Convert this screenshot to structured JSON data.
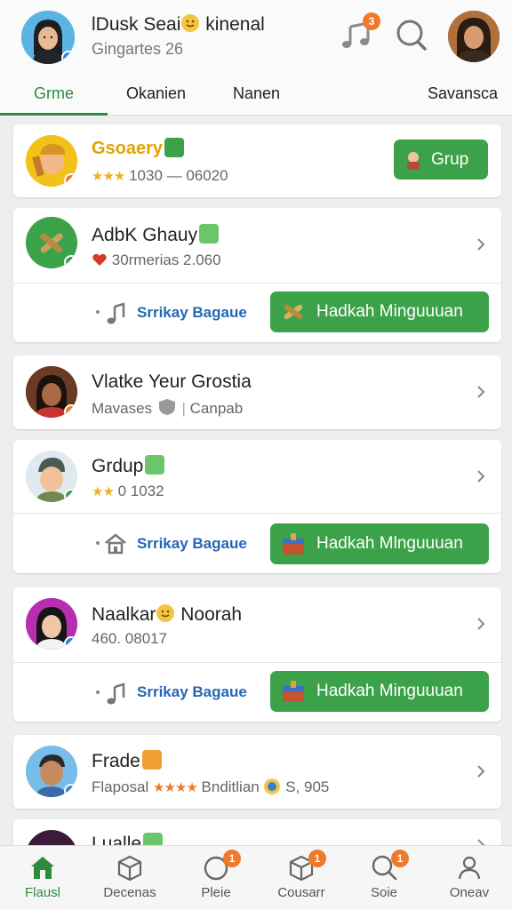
{
  "header": {
    "name": "lDusk Seai",
    "name_suffix": "kinenal",
    "subtitle": "Gingartes 26",
    "notification_count": "3"
  },
  "tabs": [
    {
      "label": "Grme",
      "active": true
    },
    {
      "label": "Okanien",
      "active": false
    },
    {
      "label": "Nanen",
      "active": false
    },
    {
      "label": "Savansca",
      "active": false
    }
  ],
  "items": [
    {
      "title": "Gsoaery",
      "meta_stars": "★★★",
      "meta_text": "1030 — 06020",
      "button": "Grup"
    },
    {
      "title": "AdbK Ghauy",
      "meta_text": "30rmerias  2.060",
      "action_left": "Srrikay Bagaue",
      "action_button": "Hadkah Minguuuan"
    },
    {
      "title": "Vlatke Yeur Grostia",
      "meta_text": "Mavases",
      "meta_text2": "Canpab"
    },
    {
      "title": "Grdup",
      "meta_stars": "★★",
      "meta_text": "0 1032",
      "action_left": "Srrikay Bagaue",
      "action_button": "Hadkah Mlnguuuan"
    },
    {
      "title": "Naalkar",
      "title_suffix": "Noorah",
      "meta_text": "460. 08017",
      "action_left": "Srrikay Bagaue",
      "action_button": "Hadkah Minguuuan"
    },
    {
      "title": "Frade",
      "meta_text": "Flaposal",
      "meta_stars": "★★★★",
      "meta_text2": "Bnditlian",
      "meta_text3": "S, 905"
    },
    {
      "title": "Lualle"
    }
  ],
  "bottom_nav": [
    {
      "label": "Flausl",
      "active": true,
      "icon": "home-icon"
    },
    {
      "label": "Decenas",
      "active": false,
      "icon": "box-icon"
    },
    {
      "label": "Pleie",
      "active": false,
      "icon": "circle-icon",
      "badge": "1"
    },
    {
      "label": "Cousarr",
      "active": false,
      "icon": "cube-icon",
      "badge": "1"
    },
    {
      "label": "Soie",
      "active": false,
      "icon": "search-icon",
      "badge": "1"
    },
    {
      "label": "Oneav",
      "active": false,
      "icon": "person-icon"
    }
  ],
  "colors": {
    "accent": "#2e8b3e",
    "button": "#3ca24a",
    "link": "#2366b5",
    "badge": "#ef7a2b",
    "star": "#f2b01e"
  }
}
